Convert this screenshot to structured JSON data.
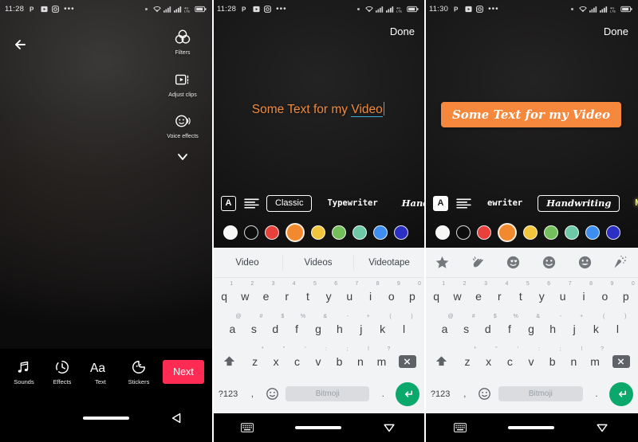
{
  "panels": [
    {
      "id": "video-preview",
      "status": {
        "time": "11:28",
        "icons": [
          "pinterest-icon",
          "video-app-icon",
          "instagram-icon",
          "more-dots-icon"
        ],
        "right_icons": [
          "dot",
          "wifi-icon",
          "signal-icon",
          "signal-alt-icon",
          "data-icon",
          "battery-icon"
        ]
      },
      "back_label": "back-arrow",
      "rail": [
        {
          "label": "Filters",
          "icon": "filters-icon"
        },
        {
          "label": "Adjust clips",
          "icon": "adjust-clips-icon"
        },
        {
          "label": "Voice effects",
          "icon": "voice-effects-icon"
        }
      ],
      "rail_more": "chevron-down-icon",
      "tools": [
        {
          "label": "Sounds",
          "icon": "music-note-icon"
        },
        {
          "label": "Effects",
          "icon": "timer-icon"
        },
        {
          "label": "Text",
          "icon": "text-aa-icon"
        },
        {
          "label": "Stickers",
          "icon": "sticker-icon"
        }
      ],
      "next_label": "Next",
      "nav": [
        "home-pill",
        "back-triangle-icon"
      ]
    },
    {
      "id": "text-edit-classic",
      "status": {
        "time": "11:28"
      },
      "done_label": "Done",
      "text_value": "Some Text for my Video",
      "text_plain": "Some Text for my ",
      "text_spelled": "Video",
      "fonts": [
        {
          "label": "Classic",
          "selected": true
        },
        {
          "label": "Typewriter",
          "selected": false
        },
        {
          "label": "Handwriting",
          "selected": false
        }
      ],
      "font_icons": [
        "text-style-a-icon",
        "text-align-icon"
      ],
      "colors": [
        "#f7f7f5",
        "#0d0d0d",
        "#e8403a",
        "#f3892f",
        "#f2c53c",
        "#73bf5c",
        "#6dc9a6",
        "#3d8ef0",
        "#2b2fc4"
      ],
      "selected_color_index": 3,
      "suggestions": [
        "Video",
        "Videos",
        "Videotape"
      ],
      "keyboard": {
        "row1": [
          {
            "k": "q",
            "n": "1"
          },
          {
            "k": "w",
            "n": "2"
          },
          {
            "k": "e",
            "n": "3"
          },
          {
            "k": "r",
            "n": "4"
          },
          {
            "k": "t",
            "n": "5"
          },
          {
            "k": "y",
            "n": "6"
          },
          {
            "k": "u",
            "n": "7"
          },
          {
            "k": "i",
            "n": "8"
          },
          {
            "k": "o",
            "n": "9"
          },
          {
            "k": "p",
            "n": "0"
          }
        ],
        "row2": [
          {
            "k": "a",
            "n": "@"
          },
          {
            "k": "s",
            "n": "#"
          },
          {
            "k": "d",
            "n": "$"
          },
          {
            "k": "f",
            "n": "%"
          },
          {
            "k": "g",
            "n": "&"
          },
          {
            "k": "h",
            "n": "-"
          },
          {
            "k": "j",
            "n": "+"
          },
          {
            "k": "k",
            "n": "("
          },
          {
            "k": "l",
            "n": ")"
          }
        ],
        "row3": [
          {
            "k": "z",
            "n": "*"
          },
          {
            "k": "x",
            "n": "\""
          },
          {
            "k": "c",
            "n": "'"
          },
          {
            "k": "v",
            "n": ":"
          },
          {
            "k": "b",
            "n": ";"
          },
          {
            "k": "n",
            "n": "!"
          },
          {
            "k": "m",
            "n": "?"
          }
        ],
        "shift": "shift-icon",
        "delete": "backspace-icon",
        "symbols": "?123",
        "comma": ",",
        "emoji": "emoji-icon",
        "space_label": "Bitmoji",
        "period": ".",
        "enter": "enter-icon"
      },
      "nav": [
        "keyboard-icon",
        "home-pill",
        "back-triangle-icon"
      ]
    },
    {
      "id": "text-edit-handwriting",
      "status": {
        "time": "11:30"
      },
      "done_label": "Done",
      "text_value": "Some Text for my Video",
      "fonts": [
        {
          "label": "ewriter",
          "selected": false
        },
        {
          "label": "Handwriting",
          "selected": true
        },
        {
          "label": "NEON",
          "selected": false
        }
      ],
      "font_icons": [
        "text-style-a-icon",
        "text-align-icon"
      ],
      "colors": [
        "#f7f7f5",
        "#0d0d0d",
        "#e8403a",
        "#f3892f",
        "#f2c53c",
        "#73bf5c",
        "#6dc9a6",
        "#3d8ef0",
        "#2b2fc4"
      ],
      "selected_color_index": 3,
      "emojis": [
        "star-icon",
        "clapping-hands-icon",
        "heart-eyes-icon",
        "smiley-icon",
        "grin-icon",
        "party-popper-icon"
      ],
      "text_chip_bg": "#f5883c",
      "nav": [
        "keyboard-icon",
        "home-pill",
        "back-triangle-icon"
      ]
    }
  ],
  "theme": {
    "accent_red": "#fe2c55",
    "accent_orange": "#f3892f",
    "enter_green": "#0aa86a",
    "keyboard_bg": "#f2f3f5"
  }
}
